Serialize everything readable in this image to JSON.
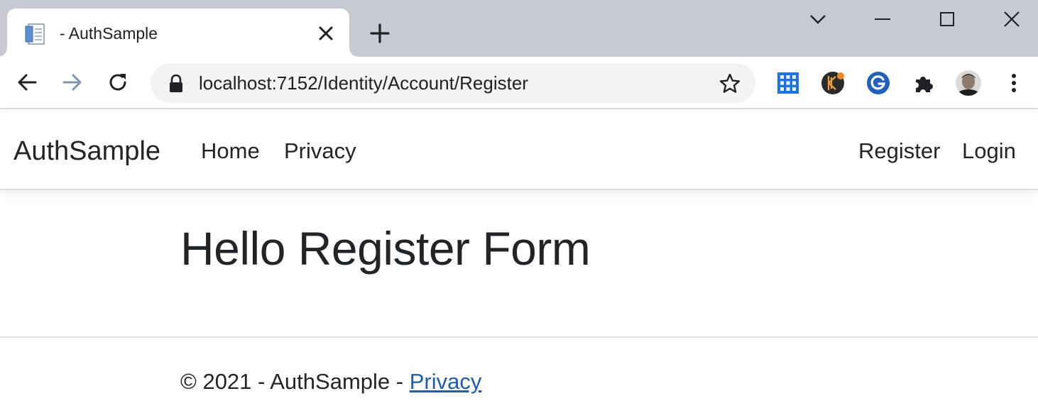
{
  "browser": {
    "tab": {
      "title": "- AuthSample"
    },
    "address_bar": {
      "url": "localhost:7152/Identity/Account/Register"
    },
    "extensions": [
      "apps-grid-icon",
      "keeper-extension-icon",
      "grammarly-extension-icon",
      "extensions-puzzle-icon",
      "profile-avatar"
    ]
  },
  "navbar": {
    "brand": "AuthSample",
    "links": [
      {
        "label": "Home"
      },
      {
        "label": "Privacy"
      }
    ],
    "auth_links": [
      {
        "label": "Register"
      },
      {
        "label": "Login"
      }
    ]
  },
  "main": {
    "heading": "Hello Register Form"
  },
  "footer": {
    "copyright": "© 2021 - AuthSample - ",
    "privacy_link": "Privacy"
  },
  "colors": {
    "tabstrip_bg": "#c7cad3",
    "omnibox_bg": "#f1f3f4",
    "text": "#212529",
    "link": "#1b5fb4"
  }
}
